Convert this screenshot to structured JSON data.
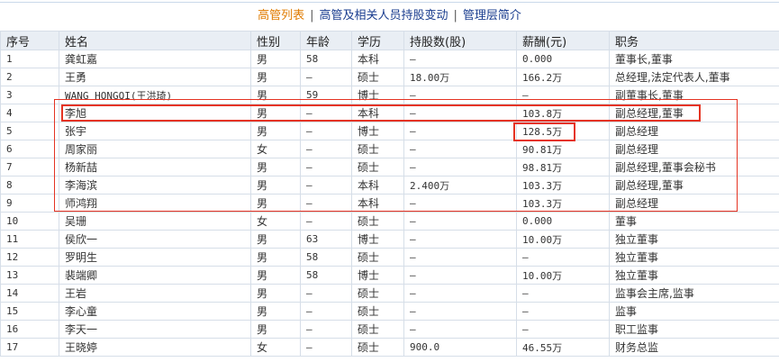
{
  "tabs": [
    {
      "label": "高管列表",
      "active": true
    },
    {
      "label": "高管及相关人员持股变动"
    },
    {
      "label": "管理层简介"
    }
  ],
  "separator": "|",
  "table": {
    "headers": [
      "序号",
      "姓名",
      "性别",
      "年龄",
      "学历",
      "持股数(股)",
      "薪酬(元)",
      "职务"
    ],
    "rows": [
      [
        "1",
        "龚虹嘉",
        "男",
        "58",
        "本科",
        "—",
        "0.000",
        "董事长,董事"
      ],
      [
        "2",
        "王勇",
        "男",
        "—",
        "硕士",
        "18.00万",
        "166.2万",
        "总经理,法定代表人,董事"
      ],
      [
        "3",
        "WANG HONGQI(王洪琦)",
        "男",
        "59",
        "博士",
        "—",
        "—",
        "副董事长,董事"
      ],
      [
        "4",
        "李旭",
        "男",
        "—",
        "本科",
        "—",
        "103.8万",
        "副总经理,董事"
      ],
      [
        "5",
        "张宇",
        "男",
        "—",
        "博士",
        "—",
        "128.5万",
        "副总经理"
      ],
      [
        "6",
        "周家丽",
        "女",
        "—",
        "硕士",
        "—",
        "90.81万",
        "副总经理"
      ],
      [
        "7",
        "杨新喆",
        "男",
        "—",
        "硕士",
        "—",
        "98.81万",
        "副总经理,董事会秘书"
      ],
      [
        "8",
        "李海滨",
        "男",
        "—",
        "本科",
        "2.400万",
        "103.3万",
        "副总经理,董事"
      ],
      [
        "9",
        "师鸿翔",
        "男",
        "—",
        "本科",
        "—",
        "103.3万",
        "副总经理"
      ],
      [
        "10",
        "吴珊",
        "女",
        "—",
        "硕士",
        "—",
        "0.000",
        "董事"
      ],
      [
        "11",
        "侯欣一",
        "男",
        "63",
        "博士",
        "—",
        "10.00万",
        "独立董事"
      ],
      [
        "12",
        "罗明生",
        "男",
        "58",
        "硕士",
        "—",
        "—",
        "独立董事"
      ],
      [
        "13",
        "裴端卿",
        "男",
        "58",
        "博士",
        "—",
        "10.00万",
        "独立董事"
      ],
      [
        "14",
        "王岩",
        "男",
        "—",
        "硕士",
        "—",
        "—",
        "监事会主席,监事"
      ],
      [
        "15",
        "李心童",
        "男",
        "—",
        "硕士",
        "—",
        "—",
        "监事"
      ],
      [
        "16",
        "李天一",
        "男",
        "—",
        "硕士",
        "—",
        "—",
        "职工监事"
      ],
      [
        "17",
        "王晓婷",
        "女",
        "—",
        "硕士",
        "900.0",
        "46.55万",
        "财务总监"
      ]
    ]
  },
  "colors": {
    "highlight": "#e53322",
    "active_tab": "#e07b00",
    "link": "#1a3d8f"
  }
}
